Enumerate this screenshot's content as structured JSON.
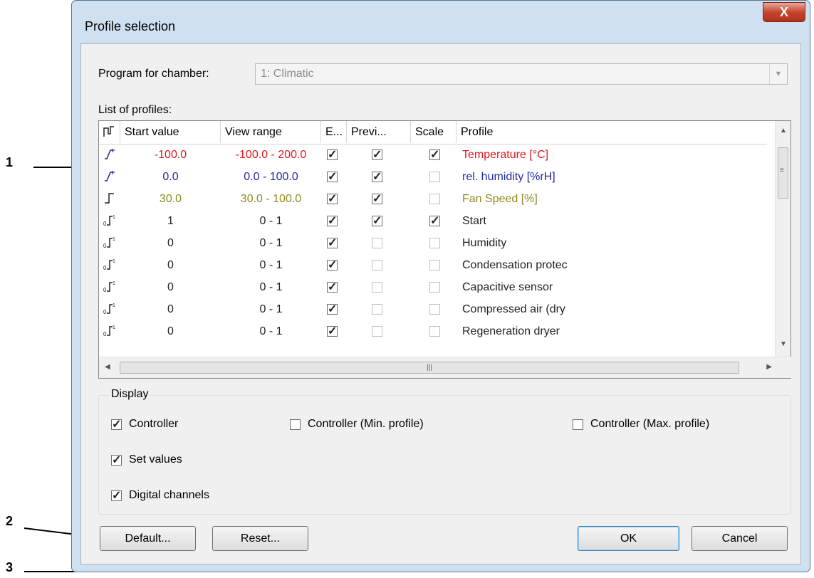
{
  "callouts": [
    "1",
    "2",
    "3"
  ],
  "dialog": {
    "title": "Profile selection",
    "close_label": "X",
    "program_label": "Program for chamber:",
    "program_value": "1: Climatic",
    "list_label": "List of profiles:",
    "columns": [
      "",
      "Start value",
      "View range",
      "E...",
      "Previ...",
      "Scale",
      "Profile"
    ],
    "rows": [
      {
        "icon": "analog-ramp-icon",
        "start": "-100.0",
        "range": "-100.0 - 200.0",
        "e": true,
        "preview": true,
        "scale": true,
        "profile": "Temperature [°C]",
        "color": "#e3171b"
      },
      {
        "icon": "analog-ramp-icon",
        "start": "0.0",
        "range": "0.0 - 100.0",
        "e": true,
        "preview": true,
        "scale": false,
        "profile": "rel. humidity [%rH]",
        "color": "#1f2aa3"
      },
      {
        "icon": "step-icon",
        "start": "30.0",
        "range": "30.0 - 100.0",
        "e": true,
        "preview": true,
        "scale": false,
        "profile": "Fan Speed [%]",
        "color": "#8d8a1f"
      },
      {
        "icon": "digital-channel-icon",
        "start": "1",
        "range": "0 - 1",
        "e": true,
        "preview": true,
        "scale": true,
        "profile": "Start",
        "color": "#222222"
      },
      {
        "icon": "digital-channel-icon",
        "start": "0",
        "range": "0 - 1",
        "e": true,
        "preview": false,
        "scale": false,
        "profile": "Humidity",
        "color": "#222222"
      },
      {
        "icon": "digital-channel-icon",
        "start": "0",
        "range": "0 - 1",
        "e": true,
        "preview": false,
        "scale": false,
        "profile": "Condensation protec",
        "color": "#222222"
      },
      {
        "icon": "digital-channel-icon",
        "start": "0",
        "range": "0 - 1",
        "e": true,
        "preview": false,
        "scale": false,
        "profile": "Capacitive sensor",
        "color": "#222222"
      },
      {
        "icon": "digital-channel-icon",
        "start": "0",
        "range": "0 - 1",
        "e": true,
        "preview": false,
        "scale": false,
        "profile": "Compressed air (dry",
        "color": "#222222"
      },
      {
        "icon": "digital-channel-icon",
        "start": "0",
        "range": "0 - 1",
        "e": true,
        "preview": false,
        "scale": false,
        "profile": "Regeneration dryer",
        "color": "#222222"
      }
    ],
    "display": {
      "title": "Display",
      "options": [
        {
          "label": "Controller",
          "checked": true
        },
        {
          "label": "Controller (Min. profile)",
          "checked": false
        },
        {
          "label": "Controller (Max. profile)",
          "checked": false
        },
        {
          "label": "Set values",
          "checked": true
        },
        {
          "label": "Digital channels",
          "checked": true
        }
      ]
    },
    "buttons": {
      "default": "Default...",
      "reset": "Reset...",
      "ok": "OK",
      "cancel": "Cancel"
    }
  }
}
